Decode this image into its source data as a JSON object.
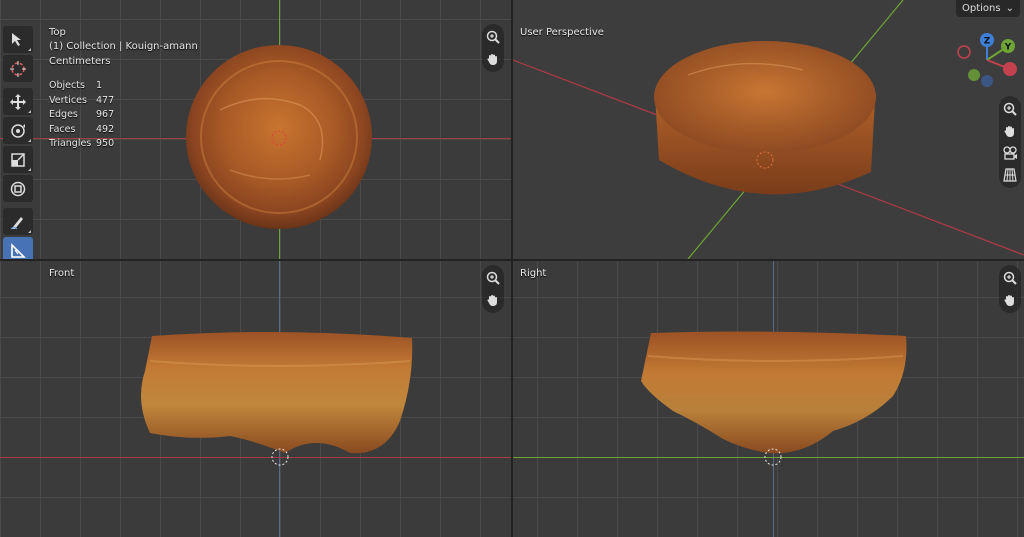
{
  "viewports": {
    "top": {
      "view_name": "Top",
      "collection": "(1) Collection | Kouign-amann",
      "units": "Centimeters"
    },
    "perspective": {
      "view_name": "User Perspective"
    },
    "front": {
      "view_name": "Front"
    },
    "right": {
      "view_name": "Right"
    }
  },
  "stats": [
    {
      "label": "Objects",
      "value": "1"
    },
    {
      "label": "Vertices",
      "value": "477"
    },
    {
      "label": "Edges",
      "value": "967"
    },
    {
      "label": "Faces",
      "value": "492"
    },
    {
      "label": "Triangles",
      "value": "950"
    }
  ],
  "header": {
    "options_label": "Options"
  },
  "gizmo": {
    "z_label": "Z",
    "y_label": "Y"
  },
  "toolbar": {
    "tools": [
      "select-box-icon",
      "cursor-icon",
      "move-icon",
      "rotate-icon",
      "scale-icon",
      "transform-icon",
      "annotate-icon",
      "measure-icon",
      "add-cube-icon",
      "shear-icon"
    ],
    "active_tool": "measure-icon"
  },
  "colors": {
    "x_axis": "#c4424e",
    "y_axis": "#6ea536",
    "z_axis": "#3d7fd9",
    "active_tool": "#4772b3"
  }
}
